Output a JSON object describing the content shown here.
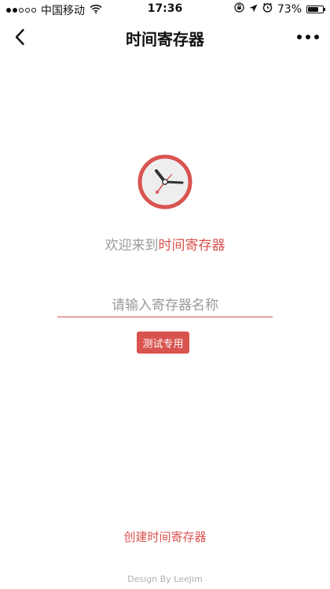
{
  "status_bar": {
    "carrier": "中国移动",
    "time": "17:36",
    "battery": "73%",
    "battery_level": 0.73,
    "icons": [
      "signal-dots-icon",
      "wifi-icon",
      "orientation-lock-icon",
      "location-arrow-icon",
      "alarm-icon",
      "battery-icon"
    ]
  },
  "nav": {
    "title": "时间寄存器",
    "back_icon": "chevron-left-icon",
    "more_icon": "more-dots-icon"
  },
  "main": {
    "clock_icon": "clock-icon",
    "welcome_prefix": "欢迎来到",
    "welcome_highlight": "时间寄存器",
    "input_placeholder": "请输入寄存器名称",
    "input_value": "",
    "test_button_label": "测试专用",
    "create_link_label": "创建时间寄存器"
  },
  "footer": {
    "credit": "Design By LeeJim"
  },
  "colors": {
    "accent": "#d9534f",
    "muted_text": "#9a9a9a",
    "clock_face": "#eeeeee",
    "clock_hands": "#333333"
  }
}
